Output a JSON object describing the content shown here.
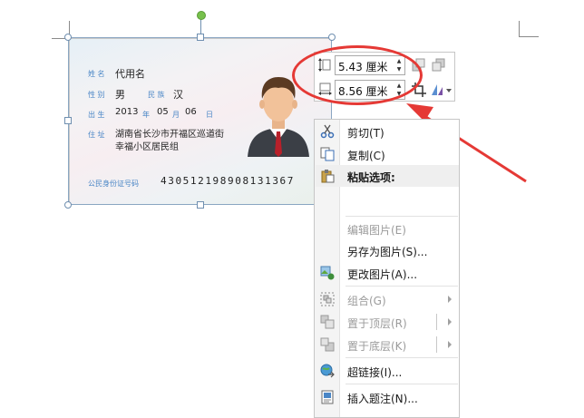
{
  "id_card": {
    "name_label": "姓 名",
    "name": "代用名",
    "gender_label": "性 别",
    "gender": "男",
    "ethnicity_label": "民 族",
    "ethnicity": "汉",
    "birth_label": "出 生",
    "birth_year": "2013",
    "year_unit": "年",
    "birth_month": "05",
    "month_unit": "月",
    "birth_day": "06",
    "day_unit": "日",
    "address_label": "住 址",
    "address_line1": "湖南省长沙市开福区巡道街",
    "address_line2": "幸福小区居民组",
    "idnum_label": "公民身份证号码",
    "idnum": "430512198908131367"
  },
  "size_toolbar": {
    "height_value": "5.43 厘米",
    "width_value": "8.56 厘米"
  },
  "context_menu": {
    "items": [
      {
        "label": "剪切(T)",
        "enabled": true,
        "icon": "scissors-icon"
      },
      {
        "label": "复制(C)",
        "enabled": true,
        "icon": "copy-icon"
      },
      {
        "label": "粘贴选项:",
        "enabled": true,
        "icon": "paste-icon"
      },
      {
        "label": "编辑图片(E)",
        "enabled": false,
        "icon": ""
      },
      {
        "label": "另存为图片(S)...",
        "enabled": true,
        "icon": ""
      },
      {
        "label": "更改图片(A)...",
        "enabled": true,
        "icon": "change-picture-icon"
      },
      {
        "label": "组合(G)",
        "enabled": false,
        "icon": "group-icon"
      },
      {
        "label": "置于顶层(R)",
        "enabled": false,
        "icon": "bring-to-front-icon"
      },
      {
        "label": "置于底层(K)",
        "enabled": false,
        "icon": "send-to-back-icon"
      },
      {
        "label": "超链接(I)...",
        "enabled": true,
        "icon": "hyperlink-icon"
      },
      {
        "label": "插入题注(N)...",
        "enabled": true,
        "icon": "insert-caption-icon"
      }
    ]
  },
  "colors": {
    "annotation_red": "#e53935",
    "label_blue": "#4a86c6",
    "rotate_handle_green": "#77c14c"
  }
}
